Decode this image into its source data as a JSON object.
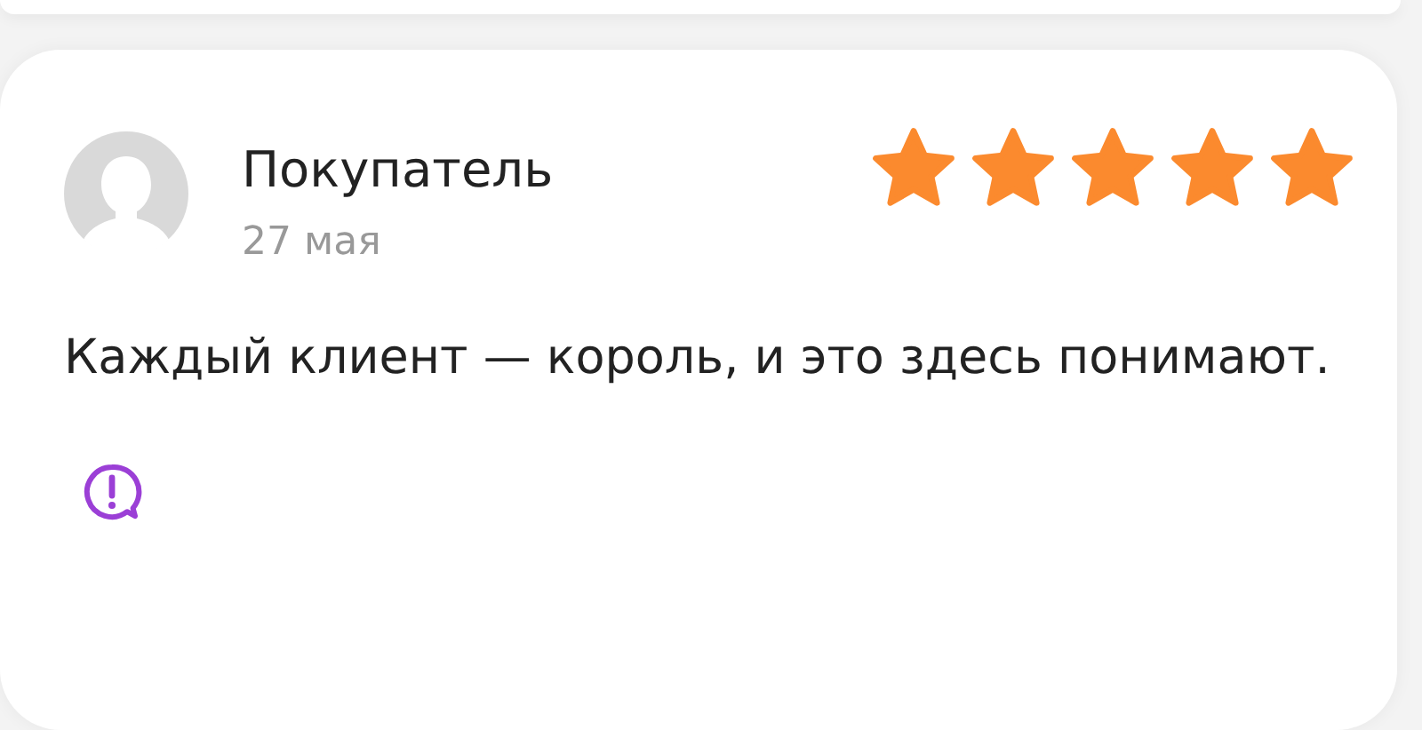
{
  "review": {
    "author": "Покупатель",
    "date": "27 мая",
    "stars": 5,
    "text": "Каждый клиент — король, и это здесь понимают."
  }
}
